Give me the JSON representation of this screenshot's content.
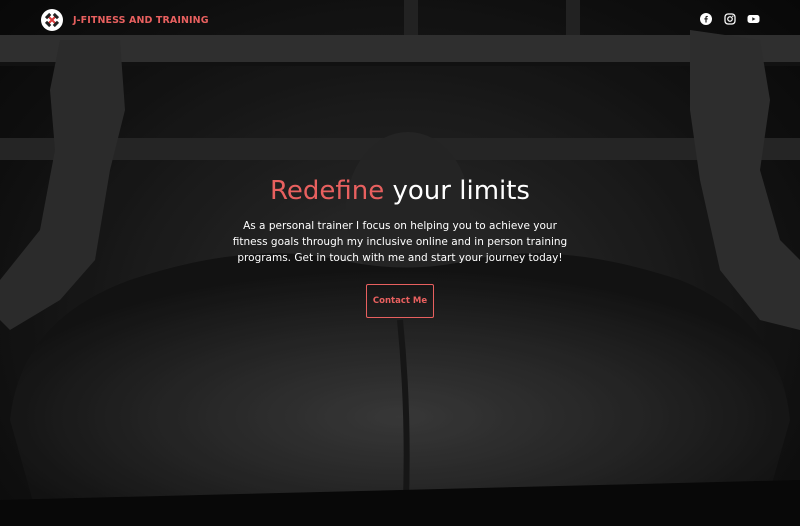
{
  "header": {
    "brand_name": "J-FITNESS AND TRAINING",
    "logo_icon": "dumbbell-x-icon",
    "socials": [
      {
        "name": "facebook-icon"
      },
      {
        "name": "instagram-icon"
      },
      {
        "name": "youtube-icon"
      }
    ]
  },
  "hero": {
    "headline_accent": "Redefine",
    "headline_rest": " your limits",
    "tagline": "As a personal trainer I focus on helping you to achieve your fitness goals through my inclusive online and in person training programs. Get in touch with me and start your journey today!",
    "cta_label": "Contact Me"
  },
  "colors": {
    "accent": "#e8605f",
    "text": "#ffffff",
    "background": "#1e1e1e"
  }
}
